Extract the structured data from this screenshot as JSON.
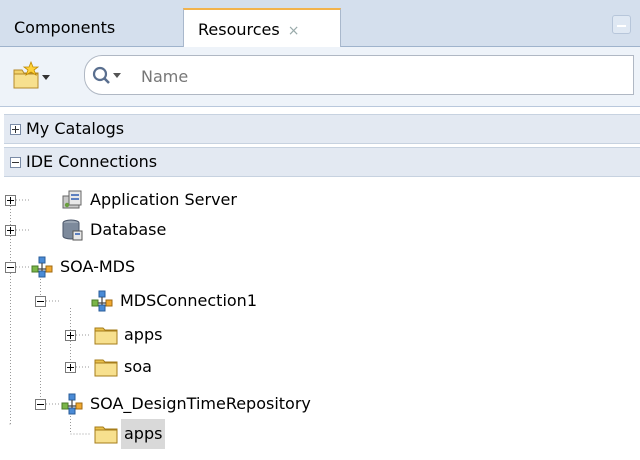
{
  "tabs": [
    {
      "label": "Components",
      "active": false
    },
    {
      "label": "Resources",
      "active": true,
      "close": "×"
    }
  ],
  "toolbar": {
    "new_icon": "new-folder-star-icon",
    "search_icon": "magnifier-dropdown-icon",
    "search_placeholder": "Name"
  },
  "sections": {
    "my_catalogs": {
      "label": "My Catalogs",
      "expanded": false
    },
    "ide_connections": {
      "label": "IDE Connections",
      "expanded": true
    }
  },
  "tree": {
    "application_server": "Application Server",
    "database": "Database",
    "soa_mds": "SOA-MDS",
    "mds_connection": "MDSConnection1",
    "mds_apps": "apps",
    "mds_soa": "soa",
    "design_time_repo": "SOA_DesignTimeRepository",
    "repo_apps": "apps"
  },
  "colors": {
    "tab_bar": "#d4dfed",
    "active_tab_accent": "#f2b34c",
    "section_bg": "#e3e9f2",
    "folder": "#f3d36b",
    "selection": "#d9d9d9"
  }
}
